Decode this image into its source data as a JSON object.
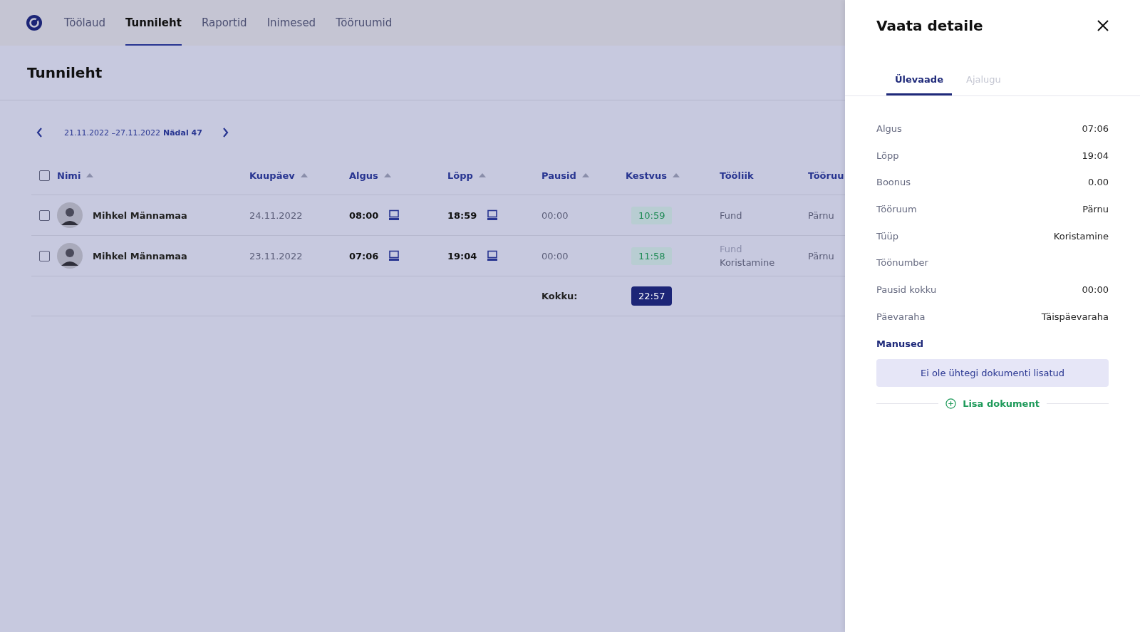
{
  "nav": {
    "tabs": [
      {
        "label": "Töölaud",
        "selected": false
      },
      {
        "label": "Tunnileht",
        "selected": true
      },
      {
        "label": "Raportid",
        "selected": false
      },
      {
        "label": "Inimesed",
        "selected": false
      },
      {
        "label": "Tööruumid",
        "selected": false
      }
    ]
  },
  "page": {
    "title": "Tunnileht",
    "date_range": "21.11.2022 –27.11.2022",
    "week": "Nädal 47"
  },
  "table": {
    "select_all": {
      "checked": false
    },
    "columns": [
      {
        "label": "Nimi",
        "sortable": true
      },
      {
        "label": "Kuupäev",
        "sortable": true
      },
      {
        "label": "Algus",
        "sortable": true
      },
      {
        "label": "Lõpp",
        "sortable": true
      },
      {
        "label": "Pausid",
        "sortable": true
      },
      {
        "label": "Kestvus",
        "sortable": true
      },
      {
        "label": "Tööliik",
        "sortable": false
      },
      {
        "label": "Tööruu"
      }
    ],
    "rows": [
      {
        "checked": false,
        "name": "Mihkel Männamaa",
        "date": "24.11.2022",
        "start": "08:00",
        "end": "18:59",
        "breaks": "00:00",
        "duration": "10:59",
        "work_type": [
          {
            "text": "Fund",
            "faded": false
          }
        ],
        "workspace": "Pärnu"
      },
      {
        "checked": false,
        "name": "Mihkel Männamaa",
        "date": "23.11.2022",
        "start": "07:06",
        "end": "19:04",
        "breaks": "00:00",
        "duration": "11:58",
        "work_type": [
          {
            "text": "Fund",
            "faded": true
          },
          {
            "text": "Koristamine",
            "faded": false
          }
        ],
        "workspace": "Pärnu"
      }
    ],
    "total_label": "Kokku:",
    "total": "22:57"
  },
  "drawer": {
    "title": "Vaata detaile",
    "tabs": [
      {
        "label": "Ülevaade",
        "selected": true
      },
      {
        "label": "Ajalugu",
        "selected": false
      }
    ],
    "details": [
      {
        "label": "Algus",
        "value": "07:06"
      },
      {
        "label": "Lõpp",
        "value": "19:04"
      },
      {
        "label": "Boonus",
        "value": "0.00"
      },
      {
        "label": "Tööruum",
        "value": "Pärnu"
      },
      {
        "label": "Tüüp",
        "value": "Koristamine"
      },
      {
        "label": "Töönumber"
      },
      {
        "label": "Pausid kokku",
        "value": "00:00"
      },
      {
        "label": "Päevaraha",
        "value": "Täispäevaraha"
      }
    ],
    "attachments_title": "Manused",
    "empty_text": "Ei ole ühtegi dokumenti lisatud",
    "add_label": "Lisa dokument"
  }
}
